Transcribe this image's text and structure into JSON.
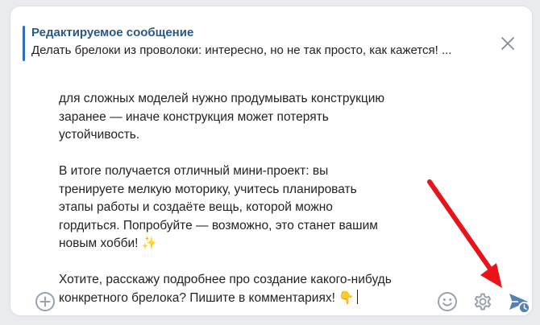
{
  "reply": {
    "title": "Редактируемое сообщение",
    "preview": "Делать брелоки из проволоки: интересно, но не так просто, как кажется! ..."
  },
  "message": {
    "lines": [
      "для сложных моделей нужно продумывать конструкцию",
      "заранее — иначе конструкция может потерять",
      "устойчивость.",
      "",
      "В итоге получается отличный мини-проект: вы",
      "тренируете мелкую моторику, учитесь планировать",
      "этапы работы и создаёте вещь, которой можно",
      "гордиться. Попробуйте — возможно, это станет вашим",
      "новым хобби! ✨",
      "",
      "Хотите, расскажу подробнее про создание какого-нибудь",
      "конкретного брелока? Пишите в комментариях! 👇"
    ]
  },
  "icons": {
    "close": "close-icon",
    "add": "add-circle-icon",
    "emoji": "smile-icon",
    "settings": "gear-icon",
    "send": "scheduled-send-icon"
  },
  "colors": {
    "accent": "#2a5885",
    "send": "#5181b8",
    "icon": "#99a2ad",
    "annotation_arrow": "#e8141a"
  }
}
